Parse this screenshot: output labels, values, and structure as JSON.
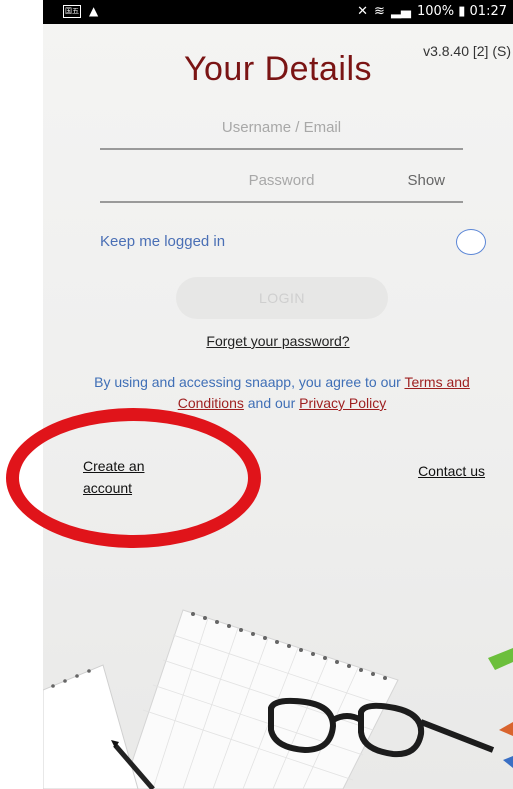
{
  "status_bar": {
    "left_icon_label": "国五",
    "right_text": "100% ▮ 01:27",
    "icons": [
      "mute-icon",
      "wifi-icon",
      "signal-icon",
      "battery-icon"
    ]
  },
  "version": "v3.8.40 [2] (S)",
  "title": "Your Details",
  "form": {
    "username_placeholder": "Username / Email",
    "password_placeholder": "Password",
    "show_label": "Show",
    "keep_logged_in_label": "Keep me logged in",
    "login_label": "LOGIN"
  },
  "forgot_password": "Forget your password?",
  "terms": {
    "prefix": "By using and accessing snaapp, you agree to our ",
    "terms_link": "Terms and Conditions",
    "middle": " and our ",
    "privacy_link": "Privacy Policy"
  },
  "links": {
    "create_account": "Create an account",
    "contact_us": "Contact us"
  },
  "colors": {
    "title": "#7a1414",
    "link_blue": "#3f6fb6",
    "link_red": "#9e1f1f",
    "annotation": "#e0141a"
  }
}
